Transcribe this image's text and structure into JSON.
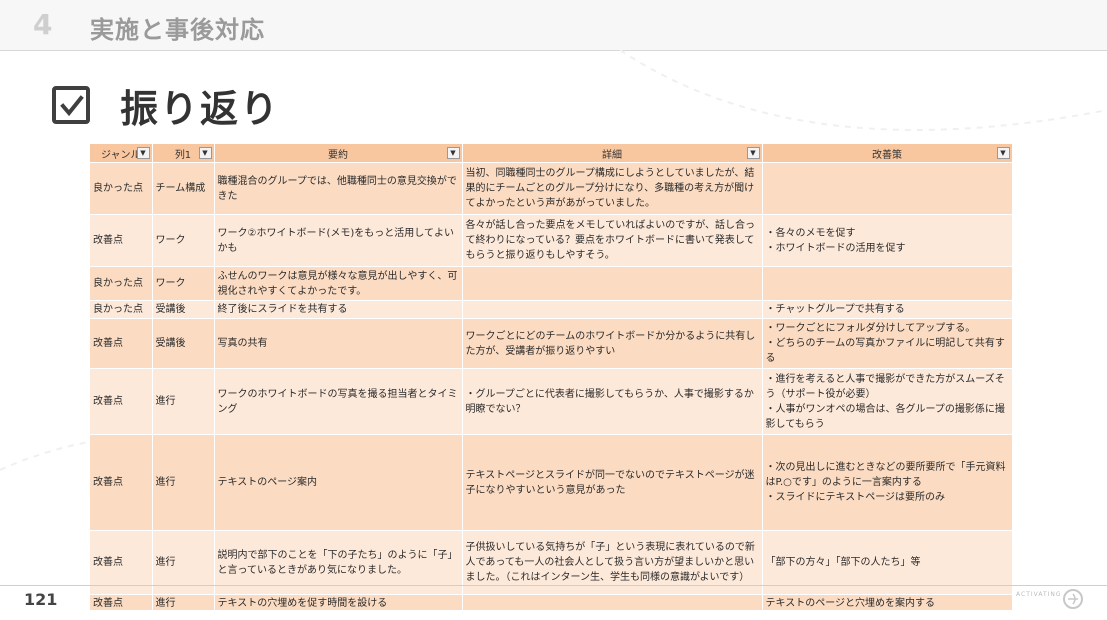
{
  "header": {
    "section_number": "4",
    "section_title": "実施と事後対応"
  },
  "heading": {
    "title": "振り返り"
  },
  "table": {
    "columns": [
      "ジャンル",
      "列1",
      "要約",
      "詳細",
      "改善策"
    ],
    "rows": [
      {
        "genre": "良かった点",
        "col1": "チーム構成",
        "summary": "職種混合のグループでは、他職種同士の意見交換ができた",
        "detail": "当初、同職種同士のグループ構成にしようとしていましたが、結果的にチームごとのグループ分けになり、多職種の考え方が聞けてよかったという声があがっていました。",
        "improvement": ""
      },
      {
        "genre": "改善点",
        "col1": "ワーク",
        "summary": "ワーク②ホワイトボード(メモ)をもっと活用してよいかも",
        "detail": "各々が話し合った要点をメモしていればよいのですが、話し合って終わりになっている？要点をホワイトボードに書いて発表してもらうと振り返りもしやすそう。",
        "improvement": "・各々のメモを促す\n・ホワイトボードの活用を促す"
      },
      {
        "genre": "良かった点",
        "col1": "ワーク",
        "summary": "ふせんのワークは意見が様々な意見が出しやすく、可視化されやすくてよかったです。",
        "detail": "",
        "improvement": ""
      },
      {
        "genre": "良かった点",
        "col1": "受講後",
        "summary": "終了後にスライドを共有する",
        "detail": "",
        "improvement": "・チャットグループで共有する"
      },
      {
        "genre": "改善点",
        "col1": "受講後",
        "summary": "写真の共有",
        "detail": "ワークごとにどのチームのホワイトボードか分かるように共有した方が、受講者が振り返りやすい",
        "improvement": "・ワークごとにフォルダ分けしてアップする。\n・どちらのチームの写真かファイルに明記して共有する"
      },
      {
        "genre": "改善点",
        "col1": "進行",
        "summary": "ワークのホワイトボードの写真を撮る担当者とタイミング",
        "detail": "・グループごとに代表者に撮影してもらうか、人事で撮影するか明瞭でない？",
        "improvement": "・進行を考えると人事で撮影ができた方がスムーズそう（サポート役が必要）\n・人事がワンオペの場合は、各グループの撮影係に撮影してもらう"
      },
      {
        "genre": "改善点",
        "col1": "進行",
        "summary": "テキストのページ案内",
        "detail": "テキストページとスライドが同一でないのでテキストページが迷子になりやすいという意見があった",
        "improvement": "・次の見出しに進むときなどの要所要所で「手元資料はP.○です」のように一言案内する\n・スライドにテキストページは要所のみ"
      },
      {
        "genre": "改善点",
        "col1": "進行",
        "summary": "説明内で部下のことを「下の子たち」のように「子」と言っているときがあり気になりました。",
        "detail": "子供扱いしている気持ちが「子」という表現に表れているので新人であっても一人の社会人として扱う言い方が望ましいかと思いました。（これはインターン生、学生も同様の意識がよいです）",
        "improvement": "「部下の方々」「部下の人たち」等"
      },
      {
        "genre": "改善点",
        "col1": "進行",
        "summary": "テキストの穴埋めを促す時間を設ける",
        "detail": "",
        "improvement": "テキストのページと穴埋めを案内する"
      }
    ]
  },
  "footer": {
    "page_number": "121",
    "brand_text": "ACTIVATING"
  },
  "colors": {
    "header_fill": "#f8c7a0",
    "row_odd": "#fbdcc3",
    "row_even": "#fde9da"
  }
}
